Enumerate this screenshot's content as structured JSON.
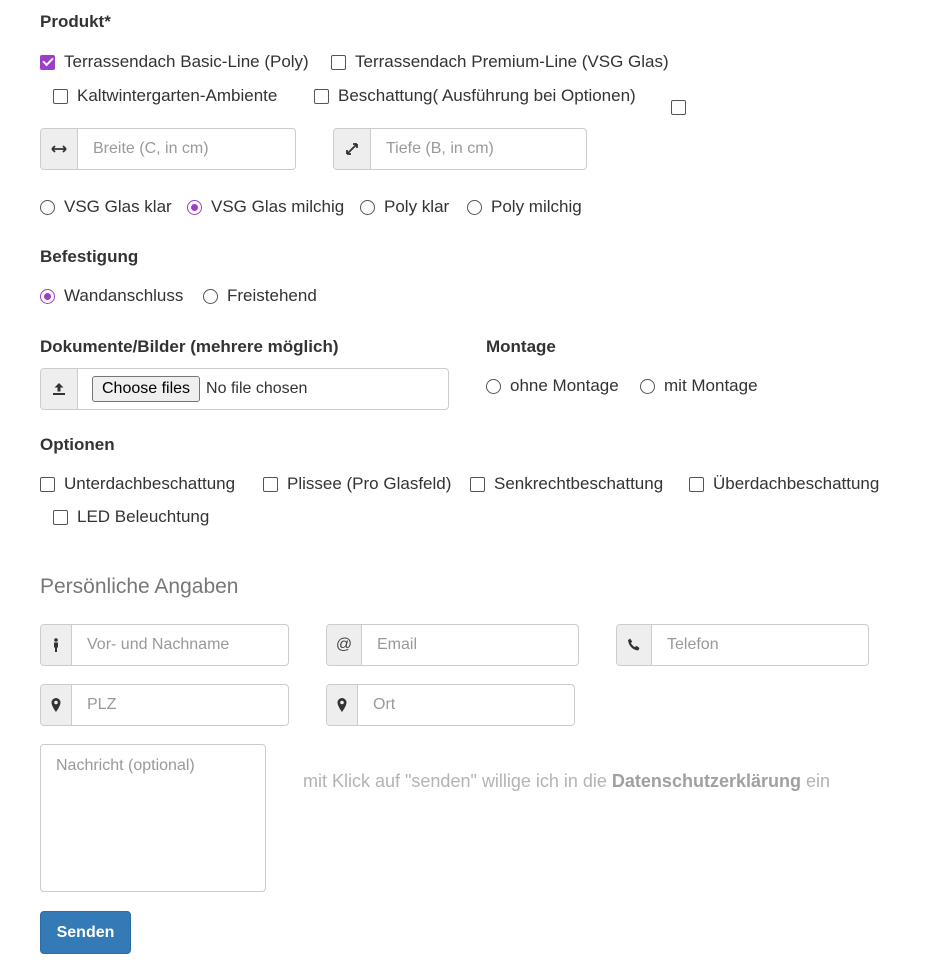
{
  "product": {
    "label": "Produkt*",
    "options": [
      {
        "label": "Terrassendach Basic-Line (Poly)",
        "checked": true
      },
      {
        "label": "Terrassendach Premium-Line (VSG Glas)",
        "checked": false
      },
      {
        "label": "Kaltwintergarten-Ambiente",
        "checked": false
      },
      {
        "label": "Beschattung( Ausführung bei Optionen)",
        "checked": false
      }
    ]
  },
  "dimensions": {
    "width_placeholder": "Breite (C, in cm)",
    "depth_placeholder": "Tiefe (B, in cm)"
  },
  "glass": {
    "options": [
      {
        "label": "VSG Glas klar",
        "checked": false
      },
      {
        "label": "VSG Glas milchig",
        "checked": true
      },
      {
        "label": "Poly klar",
        "checked": false
      },
      {
        "label": "Poly milchig",
        "checked": false
      }
    ]
  },
  "mounting": {
    "label": "Befestigung",
    "options": [
      {
        "label": "Wandanschluss",
        "checked": true
      },
      {
        "label": "Freistehend",
        "checked": false
      }
    ]
  },
  "documents": {
    "label": "Dokumente/Bilder (mehrere möglich)",
    "button": "Choose files",
    "status": "No file chosen"
  },
  "assembly": {
    "label": "Montage",
    "options": [
      {
        "label": "ohne Montage",
        "checked": false
      },
      {
        "label": "mit Montage",
        "checked": false
      }
    ]
  },
  "extras": {
    "label": "Optionen",
    "options": [
      {
        "label": "Unterdachbeschattung",
        "checked": false
      },
      {
        "label": "Plissee (Pro Glasfeld)",
        "checked": false
      },
      {
        "label": "Senkrechtbeschattung",
        "checked": false
      },
      {
        "label": "Überdachbeschattung",
        "checked": false
      },
      {
        "label": "LED Beleuchtung",
        "checked": false
      }
    ]
  },
  "personal": {
    "title": "Persönliche Angaben",
    "name_placeholder": "Vor- und Nachname",
    "email_placeholder": "Email",
    "phone_placeholder": "Telefon",
    "zip_placeholder": "PLZ",
    "city_placeholder": "Ort",
    "message_placeholder": "Nachricht (optional)",
    "email_addon": "@"
  },
  "consent": {
    "prefix": "mit Klick auf \"senden\" willige ich in die ",
    "link": "Datenschutzerklärung",
    "suffix": " ein"
  },
  "submit": {
    "label": "Senden",
    "color": "#337ab7"
  },
  "accent_color": "#9c3fc6",
  "icons": {
    "width": "arrows-horizontal-icon",
    "depth": "arrows-diagonal-icon",
    "upload": "upload-icon",
    "person": "person-icon",
    "phone": "phone-icon",
    "location": "map-marker-icon"
  }
}
